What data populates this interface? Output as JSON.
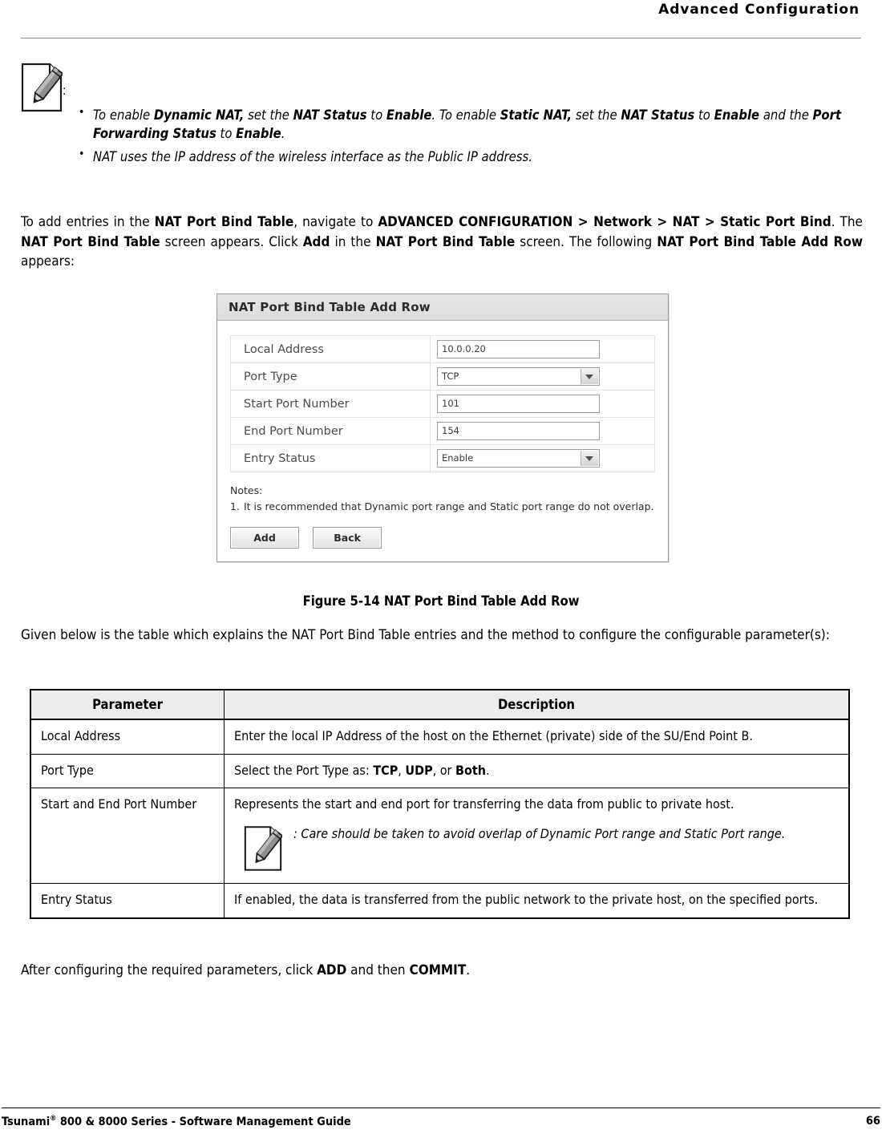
{
  "header": {
    "title": "Advanced Configuration"
  },
  "note_top": {
    "icon": "note-pencil-icon",
    "colon": ":",
    "bullets": [
      "To enable <b>Dynamic NAT,</b> set the <b>NAT Status</b> to <b>Enable</b>. To enable <b>Static NAT,</b> set the <b>NAT Status</b> to <b>Enable</b> and the <b>Port Forwarding Status</b> to <b>Enable</b>.",
      "NAT uses the IP address of the wireless interface as the Public IP address."
    ]
  },
  "paragraphs": {
    "intro": "To add entries in the <b>NAT Port Bind Table</b>, navigate to <b>ADVANCED CONFIGURATION &gt; Network &gt; NAT &gt; Static Port Bind</b>. The <b>NAT Port Bind Table</b> screen appears. Click <b>Add</b> in the <b>NAT Port Bind Table</b> screen. The following <b>NAT Port Bind Table Add Row</b> appears:",
    "given": "Given below is the table which explains the NAT Port Bind Table entries and the method to configure the configurable parameter(s):",
    "after": "After configuring the required parameters, click <b>ADD</b> and then <b>COMMIT</b>."
  },
  "figure": {
    "caption": "Figure 5-14 NAT Port Bind Table Add Row",
    "screenshot": {
      "title": "NAT Port Bind Table Add Row",
      "fields": [
        {
          "label": "Local Address",
          "type": "text",
          "value": "10.0.0.20"
        },
        {
          "label": "Port Type",
          "type": "select",
          "value": "TCP"
        },
        {
          "label": "Start Port Number",
          "type": "text",
          "value": "101"
        },
        {
          "label": "End Port Number",
          "type": "text",
          "value": "154"
        },
        {
          "label": "Entry Status",
          "type": "select",
          "value": "Enable"
        }
      ],
      "notes_title": "Notes:",
      "notes": [
        {
          "num": "1.",
          "text": "It is recommended that Dynamic port range and Static port range do not overlap."
        }
      ],
      "buttons": [
        {
          "label": "Add"
        },
        {
          "label": "Back"
        }
      ]
    }
  },
  "param_table": {
    "headers": [
      "Parameter",
      "Description"
    ],
    "rows": [
      {
        "parameter": "Local Address",
        "description": "Enter the local IP Address of the host on the Ethernet (private) side of the SU/End Point B.",
        "note": null
      },
      {
        "parameter": "Port Type",
        "description": "Select the Port Type as: <b>TCP</b>, <b>UDP</b>, or <b>Both</b>.",
        "note": null
      },
      {
        "parameter": "Start and End Port Number",
        "description": "Represents the start and end port for transferring the data from public to private host.",
        "note": ": Care should be taken to avoid overlap of Dynamic Port range and Static Port range."
      },
      {
        "parameter": "Entry Status",
        "description": "If enabled, the data is transferred from the public network to the private host, on the specified ports.",
        "note": null
      }
    ]
  },
  "footer": {
    "left_pre": "Tsunami",
    "left_sup": "®",
    "left_post": " 800 & 8000 Series - Software Management Guide",
    "page_number": "66"
  }
}
